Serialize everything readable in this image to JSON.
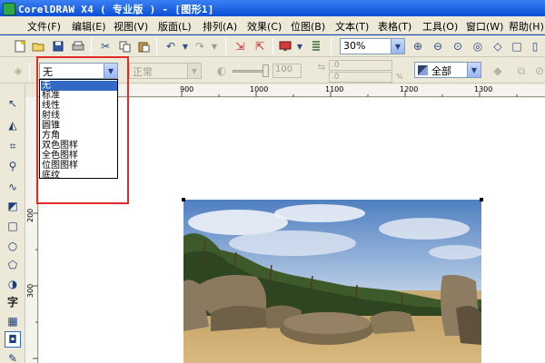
{
  "window": {
    "title": "CorelDRAW X4 ( 专业版 ) - [图形1]"
  },
  "menu": {
    "items": [
      {
        "label": "文件(F)"
      },
      {
        "label": "编辑(E)"
      },
      {
        "label": "视图(V)"
      },
      {
        "label": "版面(L)"
      },
      {
        "label": "排列(A)"
      },
      {
        "label": "效果(C)"
      },
      {
        "label": "位图(B)"
      },
      {
        "label": "文本(T)"
      },
      {
        "label": "表格(T)"
      },
      {
        "label": "工具(O)"
      },
      {
        "label": "窗口(W)"
      },
      {
        "label": "帮助(H)"
      }
    ]
  },
  "standard_toolbar": {
    "icons": [
      "new-icon",
      "open-icon",
      "save-icon",
      "print-icon",
      "cut-icon",
      "copy-icon",
      "paste-icon",
      "undo-icon",
      "redo-icon",
      "import-icon",
      "export-icon",
      "application-launcher-icon",
      "welcome-icon"
    ],
    "zoom_value": "30%",
    "zoom_icons": [
      "zoom-in-icon",
      "zoom-out-icon",
      "zoom-selected-icon",
      "zoom-all-icon",
      "zoom-page-icon",
      "zoom-width-icon",
      "zoom-height-icon"
    ]
  },
  "property_bar": {
    "fill_type_value": "无",
    "merge_mode_value": "正常",
    "midpoint_value": "100",
    "x_value": ".0",
    "y_value": ".0",
    "percent_label": "%",
    "scope_value": "全部"
  },
  "fill_type_dropdown": {
    "options": [
      {
        "label": "无",
        "selected": true
      },
      {
        "label": "标准",
        "selected": false
      },
      {
        "label": "线性",
        "selected": false
      },
      {
        "label": "射线",
        "selected": false
      },
      {
        "label": "圆锥",
        "selected": false
      },
      {
        "label": "方角",
        "selected": false
      },
      {
        "label": "双色图样",
        "selected": false
      },
      {
        "label": "全色图样",
        "selected": false
      },
      {
        "label": "位图图样",
        "selected": false
      },
      {
        "label": "底纹",
        "selected": false
      }
    ]
  },
  "rulers": {
    "horizontal_labels": [
      "900",
      "1000",
      "1100",
      "1200",
      "1300"
    ],
    "vertical_labels": [
      "200",
      "300"
    ]
  },
  "toolbox": {
    "tools": [
      "pick-tool-icon",
      "shape-tool-icon",
      "crop-tool-icon",
      "zoom-tool-icon",
      "freehand-tool-icon",
      "smart-fill-tool-icon",
      "rectangle-tool-icon",
      "ellipse-tool-icon",
      "polygon-tool-icon",
      "basic-shapes-tool-icon",
      "text-tool-icon",
      "table-tool-icon",
      "interactive-fill-tool-icon",
      "eyedropper-tool-icon"
    ],
    "text_tool_label": "字"
  },
  "colors": {
    "highlight": "#e12b2b",
    "selection": "#316ac5",
    "titlebar": "#0a4fd6"
  }
}
